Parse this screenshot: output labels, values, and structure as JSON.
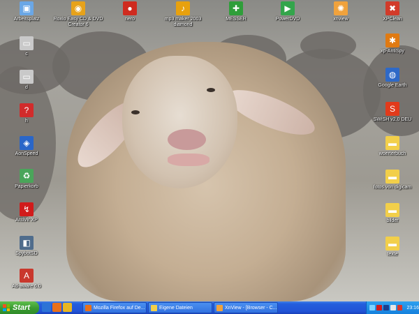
{
  "desktop": {
    "icons": [
      {
        "name": "desktop-icon-arbeitsplatz",
        "label": "Arbeitsplatz",
        "icon": "my-computer-icon",
        "color": "#6aa7e6",
        "glyph": "▣"
      },
      {
        "name": "desktop-icon-roxio",
        "label": "Roxio Easy CD & DVD Creator 6",
        "icon": "roxio-icon",
        "color": "#e7a21a",
        "glyph": "◉"
      },
      {
        "name": "desktop-icon-nero",
        "label": "nero",
        "icon": "nero-icon",
        "color": "#cf2b1f",
        "glyph": "●"
      },
      {
        "name": "desktop-icon-mp3-maker",
        "label": "mp3 maker 2003 diamond",
        "icon": "mp3-maker-icon",
        "color": "#e8a10e",
        "glyph": "♪"
      },
      {
        "name": "desktop-icon-messer",
        "label": "MESSER",
        "icon": "messer-icon",
        "color": "#2f9e3a",
        "glyph": "✚"
      },
      {
        "name": "desktop-icon-powerdvd",
        "label": "PowerDVD",
        "icon": "powerdvd-icon",
        "color": "#33a54b",
        "glyph": "▶"
      },
      {
        "name": "desktop-icon-xnview",
        "label": "xnview",
        "icon": "xnview-icon",
        "color": "#f0a23c",
        "glyph": "✺"
      },
      {
        "name": "desktop-icon-xpclean",
        "label": "XPClean",
        "icon": "xpclean-icon",
        "color": "#d23b2a",
        "glyph": "✖"
      },
      {
        "name": "desktop-icon-c",
        "label": "c",
        "icon": "drive-icon",
        "color": "#c9c9c9",
        "glyph": "▭"
      },
      {
        "name": "desktop-icon-d",
        "label": "d",
        "icon": "drive-icon",
        "color": "#c9c9c9",
        "glyph": "▭"
      },
      {
        "name": "desktop-icon-h",
        "label": "h",
        "icon": "help-icon",
        "color": "#d12b2b",
        "glyph": "?"
      },
      {
        "name": "desktop-icon-aonspeed",
        "label": "AonSpeed",
        "icon": "aonspeed-icon",
        "color": "#2a66c8",
        "glyph": "◈"
      },
      {
        "name": "desktop-icon-papierkorb",
        "label": "Papierkorb",
        "icon": "recycle-bin-icon",
        "color": "#4aa55a",
        "glyph": "♻"
      },
      {
        "name": "desktop-icon-antivir",
        "label": "AntiVir XP",
        "icon": "antivir-icon",
        "color": "#d11b1b",
        "glyph": "↯"
      },
      {
        "name": "desktop-icon-spybot",
        "label": "SpybotSD",
        "icon": "spybot-icon",
        "color": "#4f6c8c",
        "glyph": "◧"
      },
      {
        "name": "desktop-icon-adaware",
        "label": "Ad-aware 6.0",
        "icon": "adaware-icon",
        "color": "#c9382d",
        "glyph": "A"
      },
      {
        "name": "desktop-icon-xp-antispy",
        "label": "xp-AntiSpy",
        "icon": "xp-antispy-icon",
        "color": "#e07a12",
        "glyph": "✱"
      },
      {
        "name": "desktop-icon-google-earth",
        "label": "Google Earth",
        "icon": "google-earth-icon",
        "color": "#2e69c7",
        "glyph": "◍"
      },
      {
        "name": "desktop-icon-swish",
        "label": "SWiSH v2.0 DEU",
        "icon": "swish-icon",
        "color": "#e23a1b",
        "glyph": "S"
      },
      {
        "name": "desktop-icon-woerterbuch",
        "label": "woerterbuch",
        "icon": "folder-icon",
        "color": "#f2cf4a",
        "glyph": "▬"
      },
      {
        "name": "desktop-icon-fotos",
        "label": "fotos von digicam",
        "icon": "folder-icon",
        "color": "#f2cf4a",
        "glyph": "▬"
      },
      {
        "name": "desktop-icon-bilder",
        "label": "bilder",
        "icon": "folder-icon",
        "color": "#f2cf4a",
        "glyph": "▬"
      },
      {
        "name": "desktop-icon-texte",
        "label": "texte",
        "icon": "folder-icon",
        "color": "#f2cf4a",
        "glyph": "▬"
      }
    ]
  },
  "taskbar": {
    "start_label": "Start",
    "quick_launch": [
      {
        "name": "ql-ie-icon",
        "color": "#2c73d6"
      },
      {
        "name": "ql-firefox-icon",
        "color": "#e8701a"
      },
      {
        "name": "ql-media-icon",
        "color": "#e8b620"
      }
    ],
    "tasks": [
      {
        "name": "task-firefox",
        "label": "Mozilla Firefox auf De...",
        "icon": "firefox-icon",
        "color": "#e8701a"
      },
      {
        "name": "task-eigene-dateien",
        "label": "Eigene Dateien",
        "icon": "folder-icon",
        "color": "#f2cf4a"
      },
      {
        "name": "task-xnview",
        "label": "XnView - [Browser - C...",
        "icon": "xnview-icon",
        "color": "#f0a23c"
      }
    ],
    "tray_icons": [
      {
        "name": "tray-network-icon",
        "color": "#7fd3ff"
      },
      {
        "name": "tray-antivir-icon",
        "color": "#d11b1b"
      },
      {
        "name": "tray-monitor-icon",
        "color": "#1b3f8f"
      },
      {
        "name": "tray-volume-icon",
        "color": "#e6e6e6"
      },
      {
        "name": "tray-app-icon",
        "color": "#d9352a"
      }
    ],
    "clock": "23:16"
  }
}
